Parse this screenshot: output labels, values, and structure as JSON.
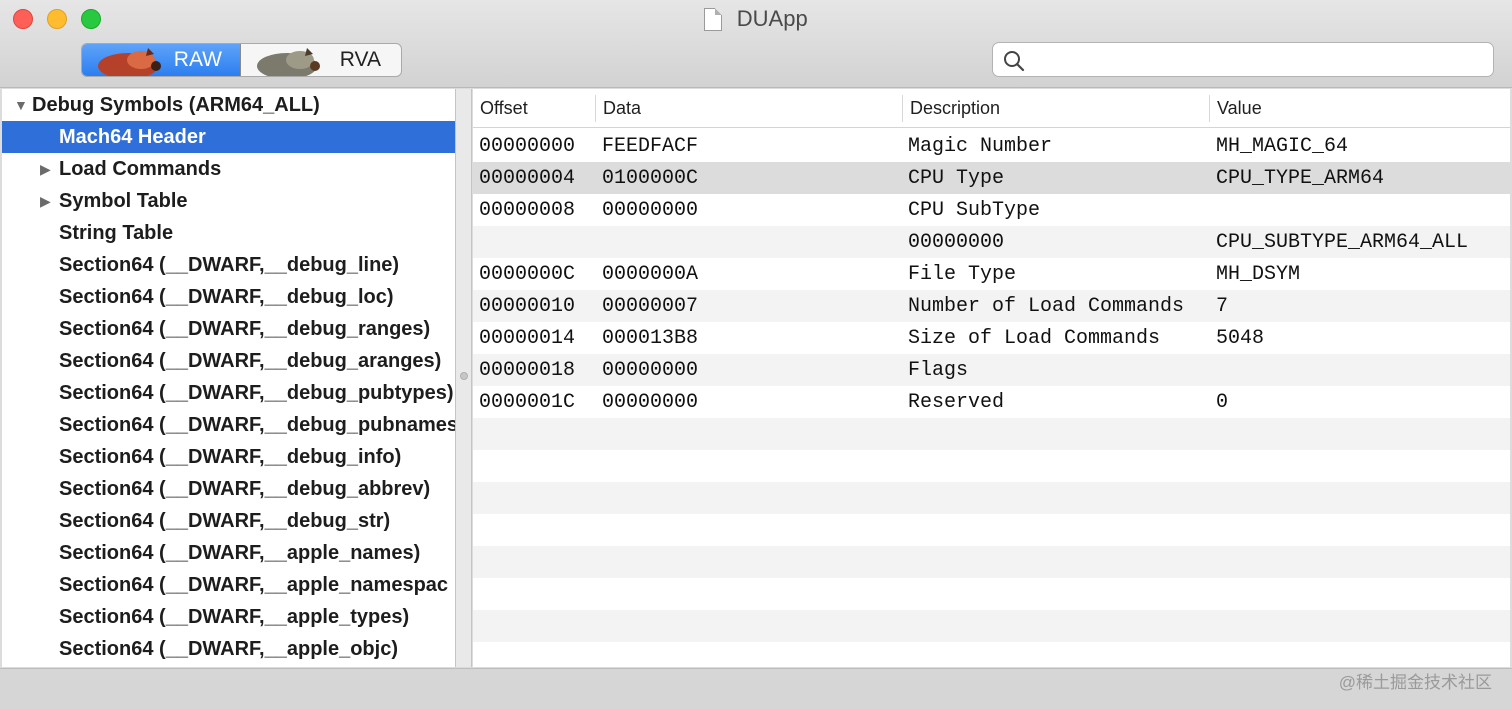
{
  "window": {
    "title": "DUApp"
  },
  "toolbar": {
    "segments": [
      {
        "label": "RAW",
        "selected": true
      },
      {
        "label": "RVA",
        "selected": false
      }
    ],
    "search": {
      "value": "",
      "placeholder": ""
    }
  },
  "sidebar": {
    "items": [
      {
        "label": "Debug Symbols (ARM64_ALL)",
        "disclosure": "▼",
        "level": 0
      },
      {
        "label": "Mach64 Header",
        "disclosure": "",
        "level": 1,
        "selected": true
      },
      {
        "label": "Load Commands",
        "disclosure": "▶",
        "level": 1
      },
      {
        "label": "Symbol Table",
        "disclosure": "▶",
        "level": 1
      },
      {
        "label": "String Table",
        "disclosure": "",
        "level": 1
      },
      {
        "label": "Section64 (__DWARF,__debug_line)",
        "disclosure": "",
        "level": 1
      },
      {
        "label": "Section64 (__DWARF,__debug_loc)",
        "disclosure": "",
        "level": 1
      },
      {
        "label": "Section64 (__DWARF,__debug_ranges)",
        "disclosure": "",
        "level": 1
      },
      {
        "label": "Section64 (__DWARF,__debug_aranges)",
        "disclosure": "",
        "level": 1
      },
      {
        "label": "Section64 (__DWARF,__debug_pubtypes)",
        "disclosure": "",
        "level": 1
      },
      {
        "label": "Section64 (__DWARF,__debug_pubnames)",
        "disclosure": "",
        "level": 1
      },
      {
        "label": "Section64 (__DWARF,__debug_info)",
        "disclosure": "",
        "level": 1
      },
      {
        "label": "Section64 (__DWARF,__debug_abbrev)",
        "disclosure": "",
        "level": 1
      },
      {
        "label": "Section64 (__DWARF,__debug_str)",
        "disclosure": "",
        "level": 1
      },
      {
        "label": "Section64 (__DWARF,__apple_names)",
        "disclosure": "",
        "level": 1
      },
      {
        "label": "Section64 (__DWARF,__apple_namespac",
        "disclosure": "",
        "level": 1
      },
      {
        "label": "Section64 (__DWARF,__apple_types)",
        "disclosure": "",
        "level": 1
      },
      {
        "label": "Section64 (__DWARF,__apple_objc)",
        "disclosure": "",
        "level": 1
      }
    ]
  },
  "table": {
    "columns": [
      "Offset",
      "Data",
      "Description",
      "Value"
    ],
    "rows": [
      [
        "00000000",
        "FEEDFACF",
        "Magic Number",
        "MH_MAGIC_64"
      ],
      [
        "00000004",
        "0100000C",
        "CPU Type",
        "CPU_TYPE_ARM64"
      ],
      [
        "00000008",
        "00000000",
        "CPU SubType",
        ""
      ],
      [
        "",
        "",
        "00000000",
        "CPU_SUBTYPE_ARM64_ALL"
      ],
      [
        "0000000C",
        "0000000A",
        "File Type",
        "MH_DSYM"
      ],
      [
        "00000010",
        "00000007",
        "Number of Load Commands",
        "7"
      ],
      [
        "00000014",
        "000013B8",
        "Size of Load Commands",
        "5048"
      ],
      [
        "00000018",
        "00000000",
        "Flags",
        ""
      ],
      [
        "0000001C",
        "00000000",
        "Reserved",
        "0"
      ]
    ],
    "selected_row": 1
  },
  "watermark": "@稀土掘金技术社区",
  "colors": {
    "selection": "#2f6fd9",
    "row_alt": "#f3f3f3",
    "row_selected": "#dcdcdc"
  }
}
